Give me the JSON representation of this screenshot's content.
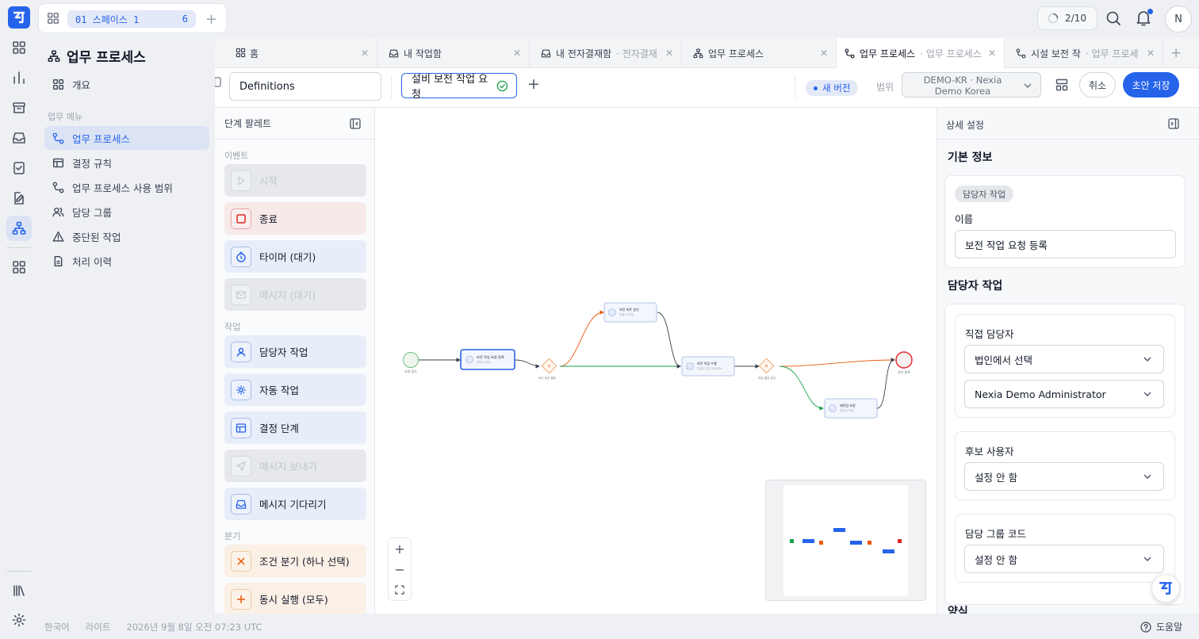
{
  "space": {
    "label": "01 스페이스 1",
    "count": "6"
  },
  "status": {
    "counter": "2/10",
    "avatar": "N"
  },
  "sidebar": {
    "title": "업무 프로세스",
    "overview": "개요",
    "section": "업무 메뉴",
    "items": [
      {
        "label": "업무 프로세스",
        "icon": "workflow-icon"
      },
      {
        "label": "결정 규칙",
        "icon": "table-icon"
      },
      {
        "label": "업무 프로세스 사용 범위",
        "icon": "workflow-icon"
      },
      {
        "label": "담당 그룹",
        "icon": "users-icon"
      },
      {
        "label": "중단된 작업",
        "icon": "warning-icon"
      },
      {
        "label": "처리 이력",
        "icon": "document-icon"
      }
    ]
  },
  "tabs": [
    {
      "label": "홈",
      "sub": ""
    },
    {
      "label": "내 작업함",
      "sub": ""
    },
    {
      "label": "내 전자결재함",
      "sub": "· 전자결재"
    },
    {
      "label": "업무 프로세스",
      "sub": ""
    },
    {
      "label": "업무 프로세스",
      "sub": "· 업무 프로세스"
    },
    {
      "label": "시설 보전 작",
      "sub": "· 업무 프로세"
    }
  ],
  "toolbar": {
    "definitions": "Definitions",
    "process_name": "설비 보전 작업 요청",
    "new_version": "새 버전",
    "scope_label": "범위",
    "scope_value_1": "DEMO-KR · Nexia",
    "scope_value_2": "Demo Korea",
    "cancel": "취소",
    "save": "초안 저장"
  },
  "palette": {
    "title": "단계 팔레트",
    "sections": {
      "events": "이벤트",
      "tasks": "작업",
      "branches": "분기"
    },
    "items": {
      "start": "시작",
      "end": "종료",
      "timer": "타이머 (대기)",
      "message_wait": "메시지 (대기)",
      "user_task": "담당자 작업",
      "auto_task": "자동 작업",
      "decision": "결정 단계",
      "message_send": "메시지 보내기",
      "message_wait2": "메시지 기다리기",
      "xor": "조건 분기 (하나 선택)",
      "parallel": "동시 실행 (모두)"
    }
  },
  "diagram": {
    "start": "요청 접수",
    "task1": "보전 작업 요청 등록",
    "task1_sub": "담당자 작업",
    "gw1": "외주 승인 필요",
    "task2": "보전 외주 승인",
    "task2_sub": "담당자 작업",
    "task3": "보전 작업 수행",
    "task3_sub": "연결된 업무 프로세스",
    "gw2": "작업 결과 분기",
    "task4": "재작업 요청",
    "task4_sub": "담당자 작업",
    "end": "처리 완료"
  },
  "details": {
    "title": "상세 설정",
    "basic": "기본 정보",
    "badge": "담당자 작업",
    "name_label": "이름",
    "name_value": "보전 작업 요청 등록",
    "assignee_header": "담당자 작업",
    "direct_label": "직접 담당자",
    "direct_select": "법인에서 선택",
    "direct_user": "Nexia Demo Administrator",
    "candidate_label": "후보 사용자",
    "candidate_value": "설정 안 함",
    "group_label": "담당 그룹 코드",
    "group_value": "설정 안 함",
    "form_header": "양식"
  },
  "footer": {
    "lang": "한국어",
    "theme": "라이트",
    "datetime": "2026년 9월 8일 오전 07:23 UTC",
    "help": "도움말"
  },
  "colors": {
    "accent": "#2563eb",
    "danger": "#dc2626",
    "warning": "#ea580c",
    "success": "#16a34a"
  }
}
